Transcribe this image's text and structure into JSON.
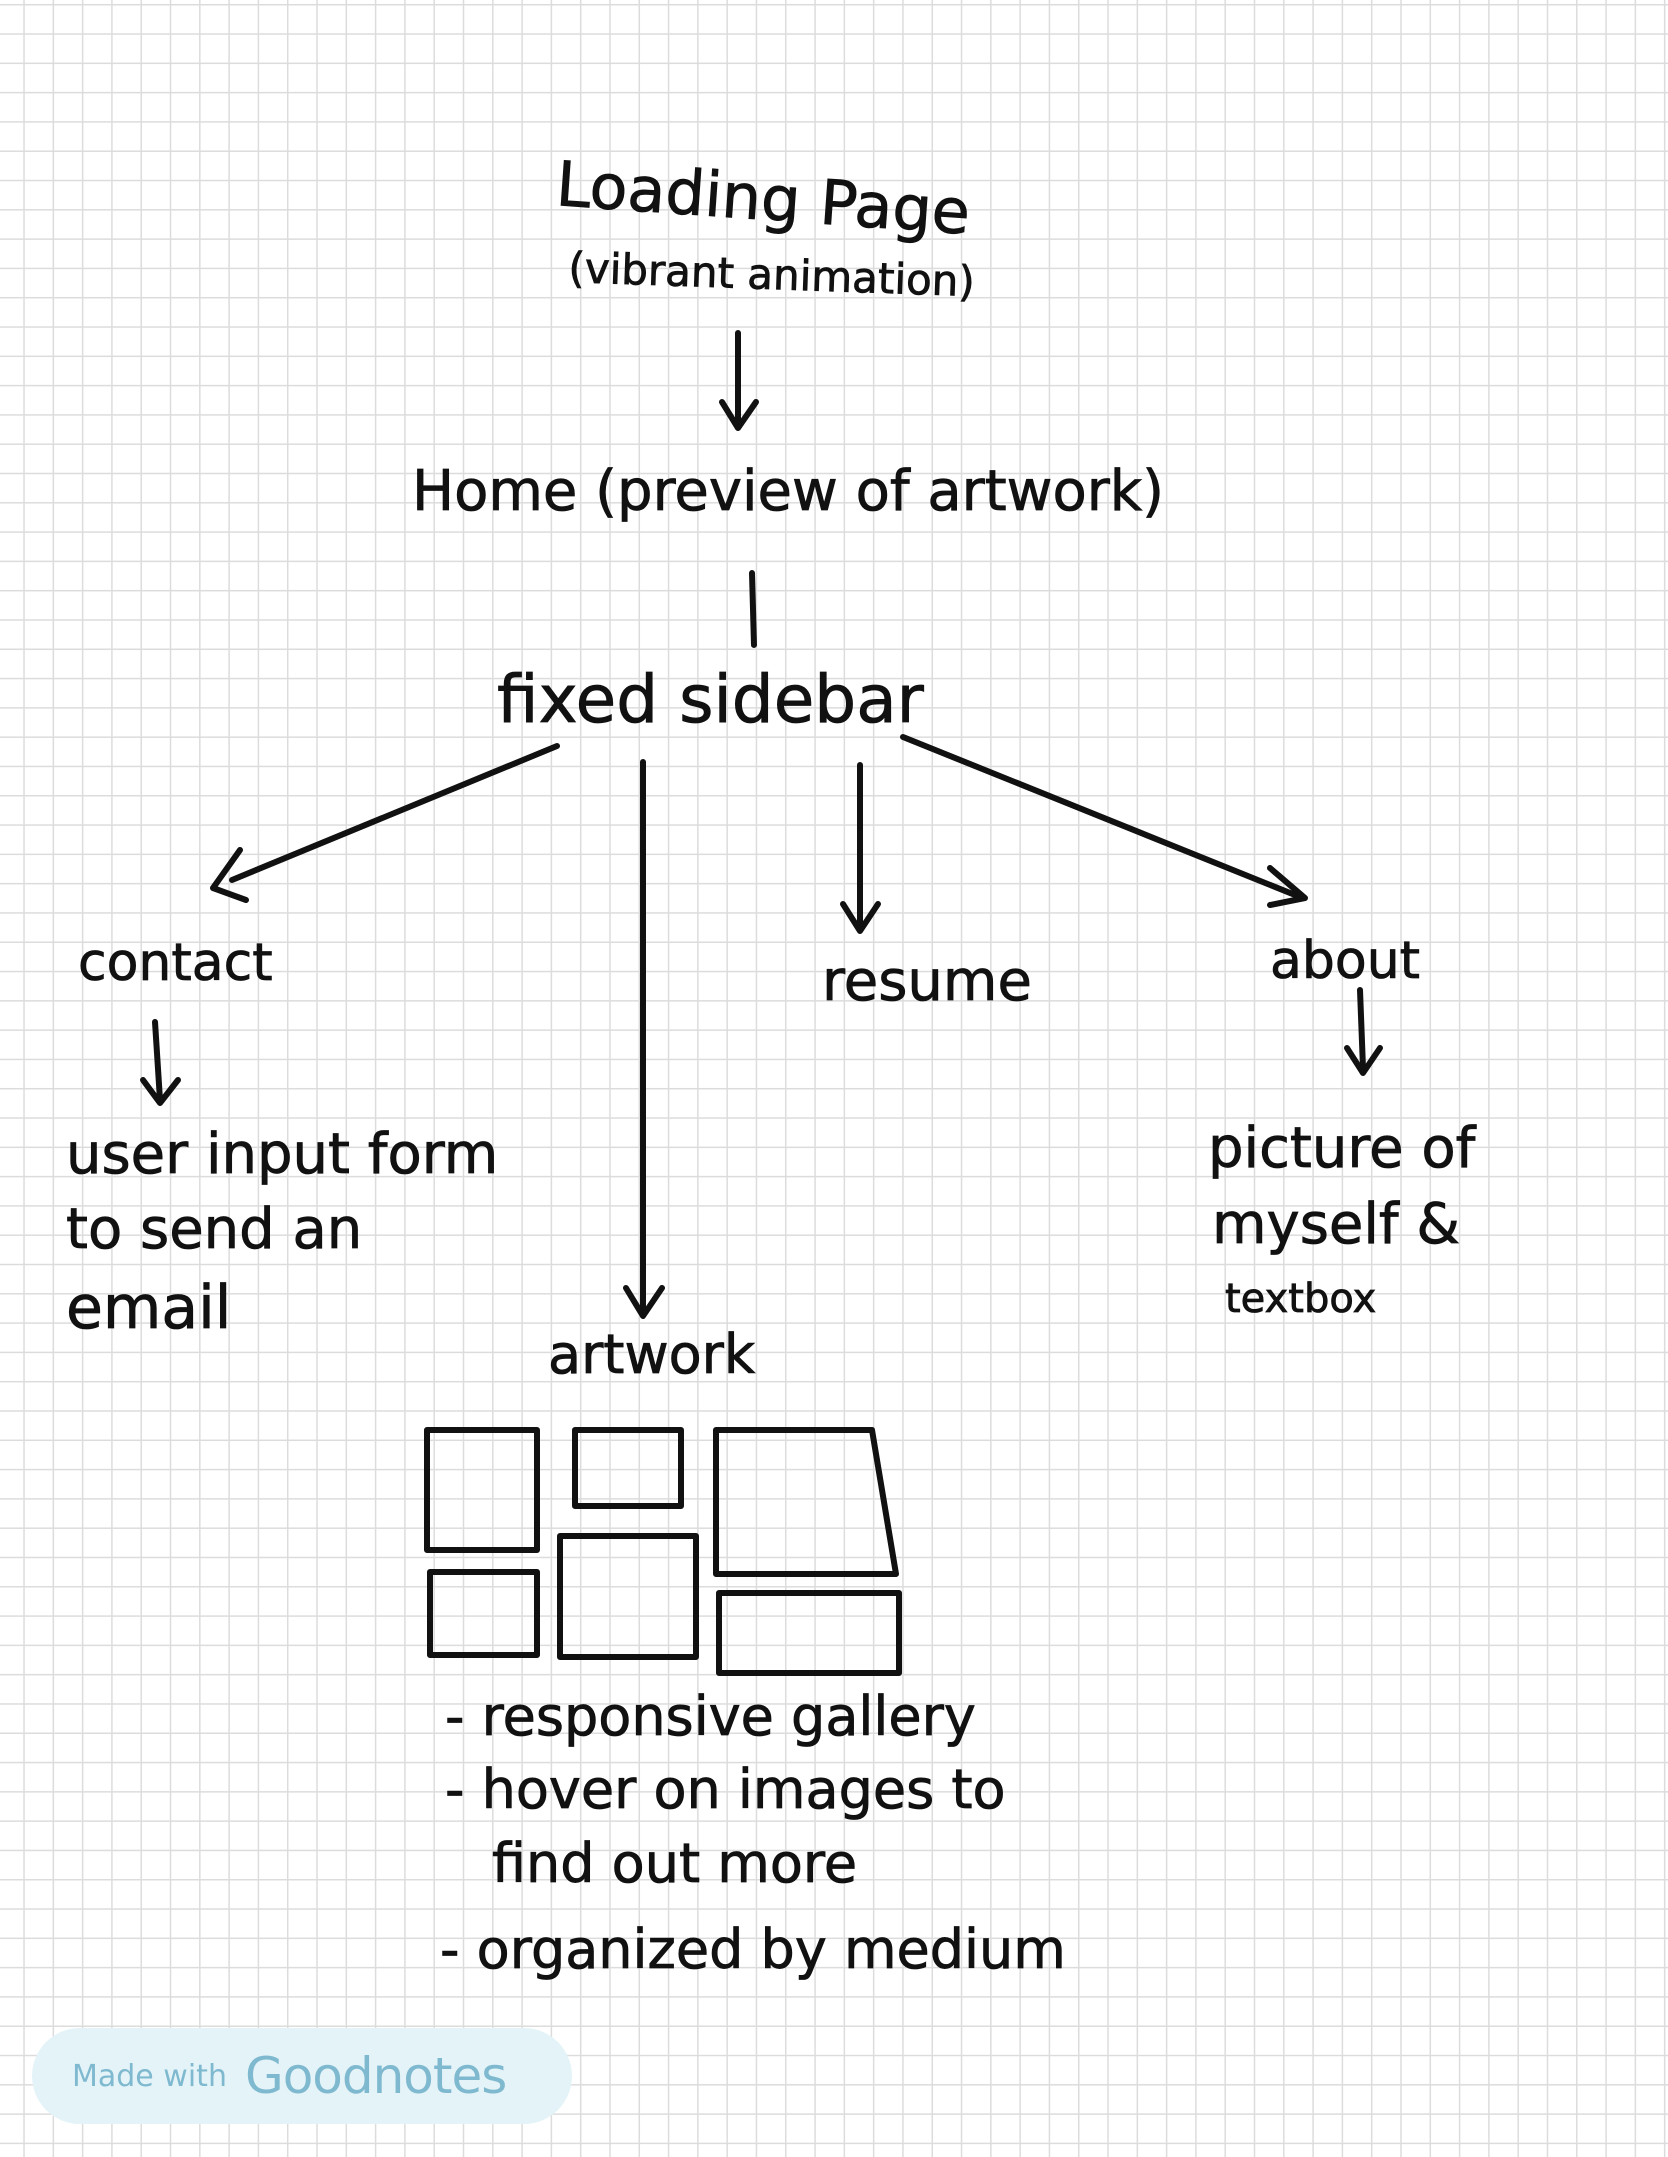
{
  "nodes": {
    "loading_title": "Loading Page",
    "loading_sub": "(vibrant animation)",
    "home": "Home (preview of artwork)",
    "sidebar": "fixed sidebar",
    "contact": "contact",
    "resume": "resume",
    "about": "about",
    "artwork": "artwork"
  },
  "contact_detail": [
    "user input form",
    "to send an",
    "email"
  ],
  "about_detail": [
    "picture of",
    "myself &",
    "textbox"
  ],
  "artwork_notes": [
    "- responsive gallery",
    "- hover on images to",
    "find out more",
    "- organized by medium"
  ],
  "badge": {
    "prefix": "Made with",
    "brand": "Goodnotes"
  },
  "colors": {
    "ink": "#111111",
    "grid": "#dcdcdc",
    "badge_bg": "#e4f3f8",
    "badge_text": "#7fb9cf"
  }
}
